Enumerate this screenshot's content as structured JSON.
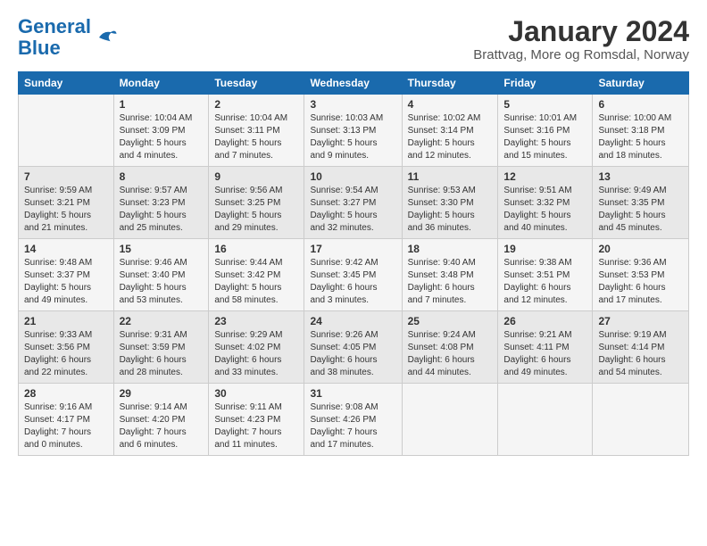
{
  "logo": {
    "line1": "General",
    "line2": "Blue"
  },
  "title": "January 2024",
  "subtitle": "Brattvag, More og Romsdal, Norway",
  "headers": [
    "Sunday",
    "Monday",
    "Tuesday",
    "Wednesday",
    "Thursday",
    "Friday",
    "Saturday"
  ],
  "weeks": [
    [
      {
        "day": "",
        "info": ""
      },
      {
        "day": "1",
        "info": "Sunrise: 10:04 AM\nSunset: 3:09 PM\nDaylight: 5 hours\nand 4 minutes."
      },
      {
        "day": "2",
        "info": "Sunrise: 10:04 AM\nSunset: 3:11 PM\nDaylight: 5 hours\nand 7 minutes."
      },
      {
        "day": "3",
        "info": "Sunrise: 10:03 AM\nSunset: 3:13 PM\nDaylight: 5 hours\nand 9 minutes."
      },
      {
        "day": "4",
        "info": "Sunrise: 10:02 AM\nSunset: 3:14 PM\nDaylight: 5 hours\nand 12 minutes."
      },
      {
        "day": "5",
        "info": "Sunrise: 10:01 AM\nSunset: 3:16 PM\nDaylight: 5 hours\nand 15 minutes."
      },
      {
        "day": "6",
        "info": "Sunrise: 10:00 AM\nSunset: 3:18 PM\nDaylight: 5 hours\nand 18 minutes."
      }
    ],
    [
      {
        "day": "7",
        "info": "Sunrise: 9:59 AM\nSunset: 3:21 PM\nDaylight: 5 hours\nand 21 minutes."
      },
      {
        "day": "8",
        "info": "Sunrise: 9:57 AM\nSunset: 3:23 PM\nDaylight: 5 hours\nand 25 minutes."
      },
      {
        "day": "9",
        "info": "Sunrise: 9:56 AM\nSunset: 3:25 PM\nDaylight: 5 hours\nand 29 minutes."
      },
      {
        "day": "10",
        "info": "Sunrise: 9:54 AM\nSunset: 3:27 PM\nDaylight: 5 hours\nand 32 minutes."
      },
      {
        "day": "11",
        "info": "Sunrise: 9:53 AM\nSunset: 3:30 PM\nDaylight: 5 hours\nand 36 minutes."
      },
      {
        "day": "12",
        "info": "Sunrise: 9:51 AM\nSunset: 3:32 PM\nDaylight: 5 hours\nand 40 minutes."
      },
      {
        "day": "13",
        "info": "Sunrise: 9:49 AM\nSunset: 3:35 PM\nDaylight: 5 hours\nand 45 minutes."
      }
    ],
    [
      {
        "day": "14",
        "info": "Sunrise: 9:48 AM\nSunset: 3:37 PM\nDaylight: 5 hours\nand 49 minutes."
      },
      {
        "day": "15",
        "info": "Sunrise: 9:46 AM\nSunset: 3:40 PM\nDaylight: 5 hours\nand 53 minutes."
      },
      {
        "day": "16",
        "info": "Sunrise: 9:44 AM\nSunset: 3:42 PM\nDaylight: 5 hours\nand 58 minutes."
      },
      {
        "day": "17",
        "info": "Sunrise: 9:42 AM\nSunset: 3:45 PM\nDaylight: 6 hours\nand 3 minutes."
      },
      {
        "day": "18",
        "info": "Sunrise: 9:40 AM\nSunset: 3:48 PM\nDaylight: 6 hours\nand 7 minutes."
      },
      {
        "day": "19",
        "info": "Sunrise: 9:38 AM\nSunset: 3:51 PM\nDaylight: 6 hours\nand 12 minutes."
      },
      {
        "day": "20",
        "info": "Sunrise: 9:36 AM\nSunset: 3:53 PM\nDaylight: 6 hours\nand 17 minutes."
      }
    ],
    [
      {
        "day": "21",
        "info": "Sunrise: 9:33 AM\nSunset: 3:56 PM\nDaylight: 6 hours\nand 22 minutes."
      },
      {
        "day": "22",
        "info": "Sunrise: 9:31 AM\nSunset: 3:59 PM\nDaylight: 6 hours\nand 28 minutes."
      },
      {
        "day": "23",
        "info": "Sunrise: 9:29 AM\nSunset: 4:02 PM\nDaylight: 6 hours\nand 33 minutes."
      },
      {
        "day": "24",
        "info": "Sunrise: 9:26 AM\nSunset: 4:05 PM\nDaylight: 6 hours\nand 38 minutes."
      },
      {
        "day": "25",
        "info": "Sunrise: 9:24 AM\nSunset: 4:08 PM\nDaylight: 6 hours\nand 44 minutes."
      },
      {
        "day": "26",
        "info": "Sunrise: 9:21 AM\nSunset: 4:11 PM\nDaylight: 6 hours\nand 49 minutes."
      },
      {
        "day": "27",
        "info": "Sunrise: 9:19 AM\nSunset: 4:14 PM\nDaylight: 6 hours\nand 54 minutes."
      }
    ],
    [
      {
        "day": "28",
        "info": "Sunrise: 9:16 AM\nSunset: 4:17 PM\nDaylight: 7 hours\nand 0 minutes."
      },
      {
        "day": "29",
        "info": "Sunrise: 9:14 AM\nSunset: 4:20 PM\nDaylight: 7 hours\nand 6 minutes."
      },
      {
        "day": "30",
        "info": "Sunrise: 9:11 AM\nSunset: 4:23 PM\nDaylight: 7 hours\nand 11 minutes."
      },
      {
        "day": "31",
        "info": "Sunrise: 9:08 AM\nSunset: 4:26 PM\nDaylight: 7 hours\nand 17 minutes."
      },
      {
        "day": "",
        "info": ""
      },
      {
        "day": "",
        "info": ""
      },
      {
        "day": "",
        "info": ""
      }
    ]
  ]
}
